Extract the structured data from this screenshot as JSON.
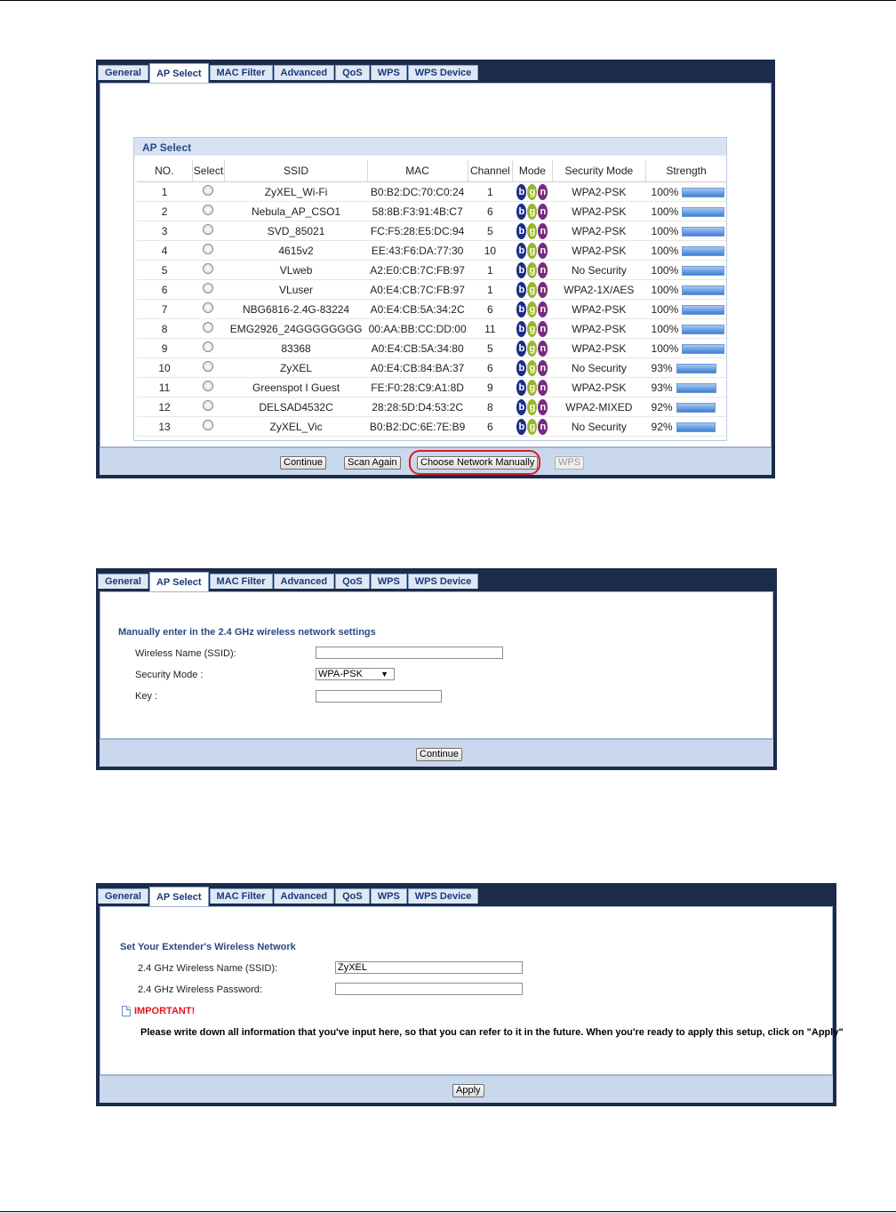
{
  "tabs": [
    "General",
    "AP Select",
    "MAC Filter",
    "Advanced",
    "QoS",
    "WPS",
    "WPS Device"
  ],
  "screen1": {
    "section_title": "AP Select",
    "columns": [
      "NO.",
      "Select",
      "SSID",
      "MAC",
      "Channel",
      "Mode",
      "Security Mode",
      "Strength"
    ],
    "rows": [
      {
        "no": "1",
        "ssid": "ZyXEL_Wi-Fi",
        "mac": "B0:B2:DC:70:C0:24",
        "channel": "1",
        "security": "WPA2-PSK",
        "strength": "100%"
      },
      {
        "no": "2",
        "ssid": "Nebula_AP_CSO1",
        "mac": "58:8B:F3:91:4B:C7",
        "channel": "6",
        "security": "WPA2-PSK",
        "strength": "100%"
      },
      {
        "no": "3",
        "ssid": "SVD_85021",
        "mac": "FC:F5:28:E5:DC:94",
        "channel": "5",
        "security": "WPA2-PSK",
        "strength": "100%"
      },
      {
        "no": "4",
        "ssid": "4615v2",
        "mac": "EE:43:F6:DA:77:30",
        "channel": "10",
        "security": "WPA2-PSK",
        "strength": "100%"
      },
      {
        "no": "5",
        "ssid": "VLweb",
        "mac": "A2:E0:CB:7C:FB:97",
        "channel": "1",
        "security": "No Security",
        "strength": "100%"
      },
      {
        "no": "6",
        "ssid": "VLuser",
        "mac": "A0:E4:CB:7C:FB:97",
        "channel": "1",
        "security": "WPA2-1X/AES",
        "strength": "100%"
      },
      {
        "no": "7",
        "ssid": "NBG6816-2.4G-83224",
        "mac": "A0:E4:CB:5A:34:2C",
        "channel": "6",
        "security": "WPA2-PSK",
        "strength": "100%"
      },
      {
        "no": "8",
        "ssid": "EMG2926_24GGGGGGGG",
        "mac": "00:AA:BB:CC:DD:00",
        "channel": "11",
        "security": "WPA2-PSK",
        "strength": "100%"
      },
      {
        "no": "9",
        "ssid": "83368",
        "mac": "A0:E4:CB:5A:34:80",
        "channel": "5",
        "security": "WPA2-PSK",
        "strength": "100%"
      },
      {
        "no": "10",
        "ssid": "ZyXEL",
        "mac": "A0:E4:CB:84:BA:37",
        "channel": "6",
        "security": "No Security",
        "strength": "93%"
      },
      {
        "no": "11",
        "ssid": "Greenspot I Guest",
        "mac": "FE:F0:28:C9:A1:8D",
        "channel": "9",
        "security": "WPA2-PSK",
        "strength": "93%"
      },
      {
        "no": "12",
        "ssid": "DELSAD4532C",
        "mac": "28:28:5D:D4:53:2C",
        "channel": "8",
        "security": "WPA2-MIXED",
        "strength": "92%"
      },
      {
        "no": "13",
        "ssid": "ZyXEL_Vic",
        "mac": "B0:B2:DC:6E:7E:B9",
        "channel": "6",
        "security": "No Security",
        "strength": "92%"
      }
    ],
    "mode_letters": [
      "b",
      "g",
      "n"
    ],
    "mode_colors": [
      "#1c2e88",
      "#9ab52a",
      "#7a2a7e"
    ],
    "buttons": {
      "continue": "Continue",
      "scan_again": "Scan Again",
      "choose_manually": "Choose Network Manually",
      "wps": "WPS"
    }
  },
  "screen2": {
    "section_title": "Manually enter in the 2.4 GHz wireless network settings",
    "ssid_label": "Wireless Name (SSID):",
    "ssid_value": "",
    "security_label": "Security Mode :",
    "security_value": "WPA-PSK",
    "key_label": "Key :",
    "key_value": "",
    "continue": "Continue"
  },
  "screen3": {
    "section_title": "Set Your Extender's Wireless Network",
    "ssid_label": "2.4 GHz Wireless Name (SSID):",
    "ssid_value": "ZyXEL",
    "password_label": "2.4 GHz Wireless Password:",
    "password_value": "",
    "important": "IMPORTANT!",
    "note": "Please write down all information that you've input here, so that you can refer to it in the future. When you're ready to apply this setup, click on \"Apply\"",
    "apply": "Apply"
  },
  "colors": {
    "highlight": "#e3161c",
    "title_blue": "#2a4a82",
    "panel_border": "#1a2b4c"
  }
}
